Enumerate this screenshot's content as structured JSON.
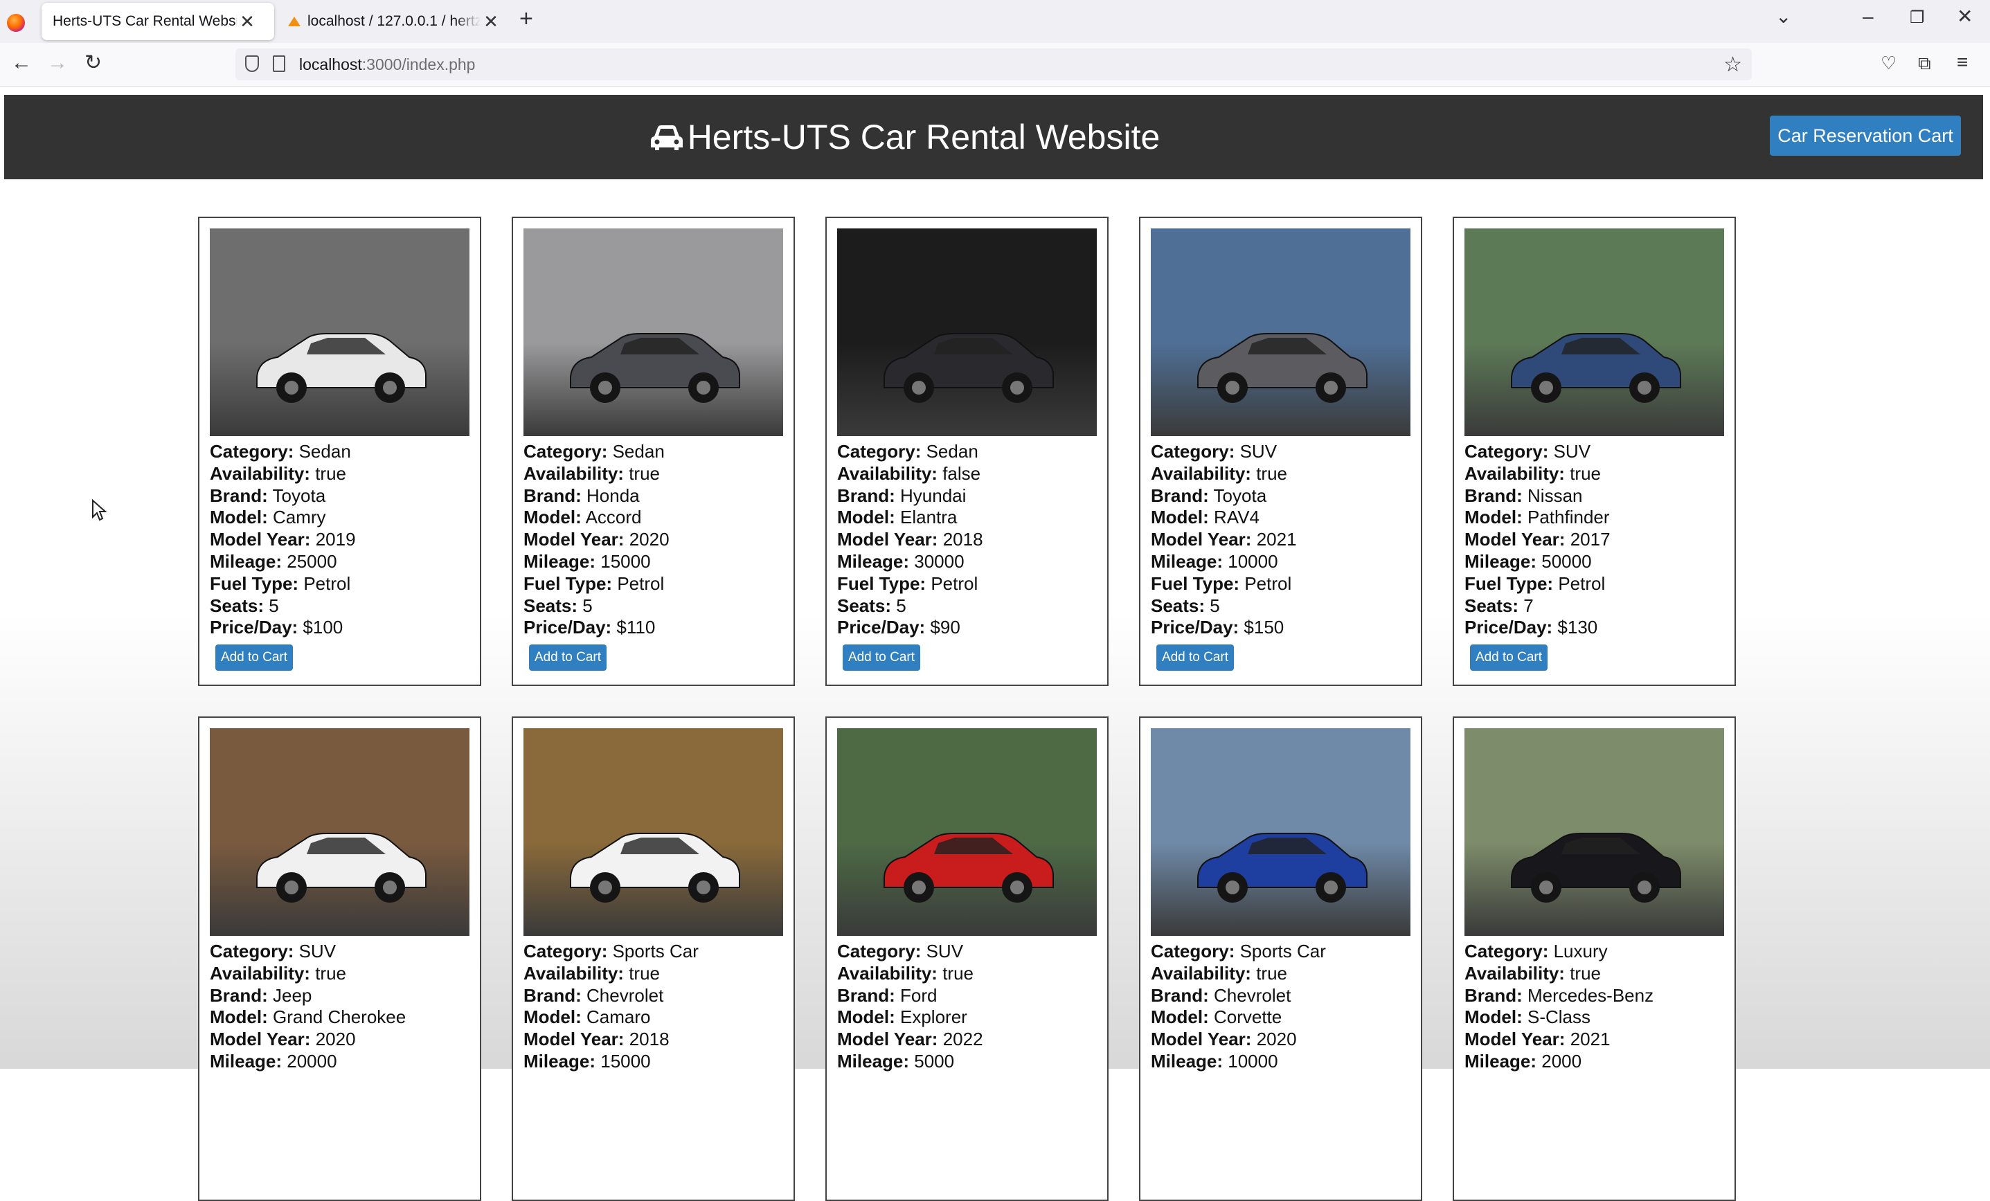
{
  "browser": {
    "tabs": [
      {
        "title": "Herts-UTS Car Rental Website",
        "active": true
      },
      {
        "title": "localhost / 127.0.0.1 / hertz_",
        "active": false
      }
    ],
    "url_host": "localhost",
    "url_path": ":3000/index.php"
  },
  "header": {
    "title": "Herts-UTS Car Rental Website",
    "cart_button": "Car Reservation Cart"
  },
  "labels": {
    "category": "Category:",
    "availability": "Availability:",
    "brand": "Brand:",
    "model": "Model:",
    "model_year": "Model Year:",
    "mileage": "Mileage:",
    "fuel_type": "Fuel Type:",
    "seats": "Seats:",
    "price": "Price/Day:",
    "add_to_cart": "Add to Cart"
  },
  "cars": [
    {
      "category": "Sedan",
      "availability": "true",
      "brand": "Toyota",
      "model": "Camry",
      "model_year": "2019",
      "mileage": "25000",
      "fuel_type": "Petrol",
      "seats": "5",
      "price": "$100",
      "bg": "#6e6e6e",
      "car_color": "#e8e8e8"
    },
    {
      "category": "Sedan",
      "availability": "true",
      "brand": "Honda",
      "model": "Accord",
      "model_year": "2020",
      "mileage": "15000",
      "fuel_type": "Petrol",
      "seats": "5",
      "price": "$110",
      "bg": "#9a9a9c",
      "car_color": "#4a4b50"
    },
    {
      "category": "Sedan",
      "availability": "false",
      "brand": "Hyundai",
      "model": "Elantra",
      "model_year": "2018",
      "mileage": "30000",
      "fuel_type": "Petrol",
      "seats": "5",
      "price": "$90",
      "bg": "#1c1c1c",
      "car_color": "#2a2a2e"
    },
    {
      "category": "SUV",
      "availability": "true",
      "brand": "Toyota",
      "model": "RAV4",
      "model_year": "2021",
      "mileage": "10000",
      "fuel_type": "Petrol",
      "seats": "5",
      "price": "$150",
      "bg": "#4f6f96",
      "car_color": "#5c5c60"
    },
    {
      "category": "SUV",
      "availability": "true",
      "brand": "Nissan",
      "model": "Pathfinder",
      "model_year": "2017",
      "mileage": "50000",
      "fuel_type": "Petrol",
      "seats": "7",
      "price": "$130",
      "bg": "#5d7a57",
      "car_color": "#2f4a78"
    },
    {
      "category": "SUV",
      "availability": "true",
      "brand": "Jeep",
      "model": "Grand Cherokee",
      "model_year": "2020",
      "mileage": "20000",
      "bg": "#7a5a3e",
      "car_color": "#f0f0f0"
    },
    {
      "category": "Sports Car",
      "availability": "true",
      "brand": "Chevrolet",
      "model": "Camaro",
      "model_year": "2018",
      "mileage": "15000",
      "bg": "#8a6a3a",
      "car_color": "#f2f2f2"
    },
    {
      "category": "SUV",
      "availability": "true",
      "brand": "Ford",
      "model": "Explorer",
      "model_year": "2022",
      "mileage": "5000",
      "bg": "#4d6a45",
      "car_color": "#c91c1c"
    },
    {
      "category": "Sports Car",
      "availability": "true",
      "brand": "Chevrolet",
      "model": "Corvette",
      "model_year": "2020",
      "mileage": "10000",
      "bg": "#6f8aa8",
      "car_color": "#1f3fa0"
    },
    {
      "category": "Luxury",
      "availability": "true",
      "brand": "Mercedes-Benz",
      "model": "S-Class",
      "model_year": "2021",
      "mileage": "2000",
      "bg": "#7d8c6a",
      "car_color": "#18181c"
    }
  ]
}
